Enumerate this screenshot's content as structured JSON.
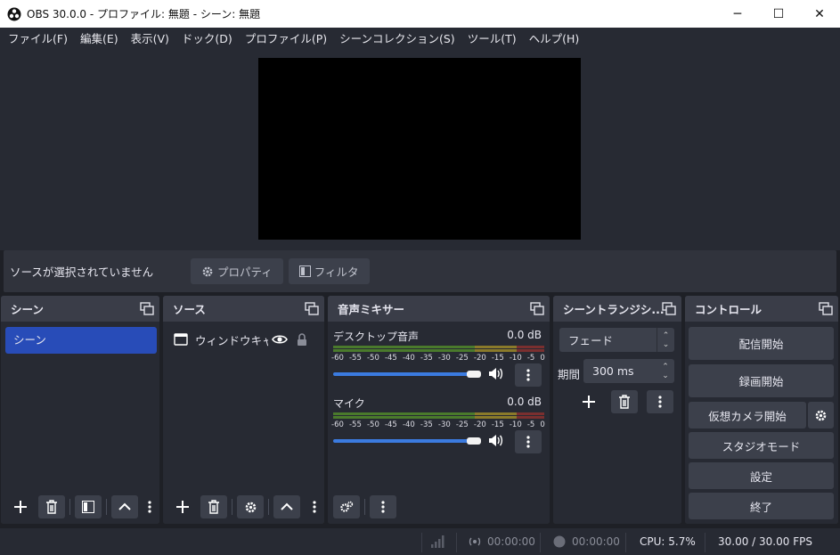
{
  "window": {
    "title": "OBS 30.0.0 - プロファイル: 無題 - シーン: 無題",
    "minimize": "─",
    "maximize": "☐",
    "close": "✕"
  },
  "menu": [
    "ファイル(F)",
    "編集(E)",
    "表示(V)",
    "ドック(D)",
    "プロファイル(P)",
    "シーンコレクション(S)",
    "ツール(T)",
    "ヘルプ(H)"
  ],
  "source_bar": {
    "status": "ソースが選択されていません",
    "properties": "プロパティ",
    "filters": "フィルタ"
  },
  "scenes": {
    "title": "シーン",
    "items": [
      "シーン"
    ]
  },
  "sources": {
    "title": "ソース",
    "items": [
      {
        "label": "ウィンドウキャプチャ"
      }
    ]
  },
  "mixer": {
    "title": "音声ミキサー",
    "ticks": [
      "-60",
      "-55",
      "-50",
      "-45",
      "-40",
      "-35",
      "-30",
      "-25",
      "-20",
      "-15",
      "-10",
      "-5",
      "0"
    ],
    "channels": [
      {
        "name": "デスクトップ音声",
        "db": "0.0 dB",
        "volume": 1.0
      },
      {
        "name": "マイク",
        "db": "0.0 dB",
        "volume": 1.0
      }
    ]
  },
  "transitions": {
    "title": "シーントランジシ...",
    "selected": "フェード",
    "duration_label": "期間",
    "duration": "300 ms"
  },
  "controls": {
    "title": "コントロール",
    "start_streaming": "配信開始",
    "start_recording": "録画開始",
    "start_virtualcam": "仮想カメラ開始",
    "studio_mode": "スタジオモード",
    "settings": "設定",
    "exit": "終了"
  },
  "status": {
    "stream_time": "00:00:00",
    "record_time": "00:00:00",
    "cpu": "CPU: 5.7%",
    "fps": "30.00 / 30.00 FPS"
  },
  "colors": {
    "accent": "#284cb8",
    "slider": "#3b7be0"
  }
}
